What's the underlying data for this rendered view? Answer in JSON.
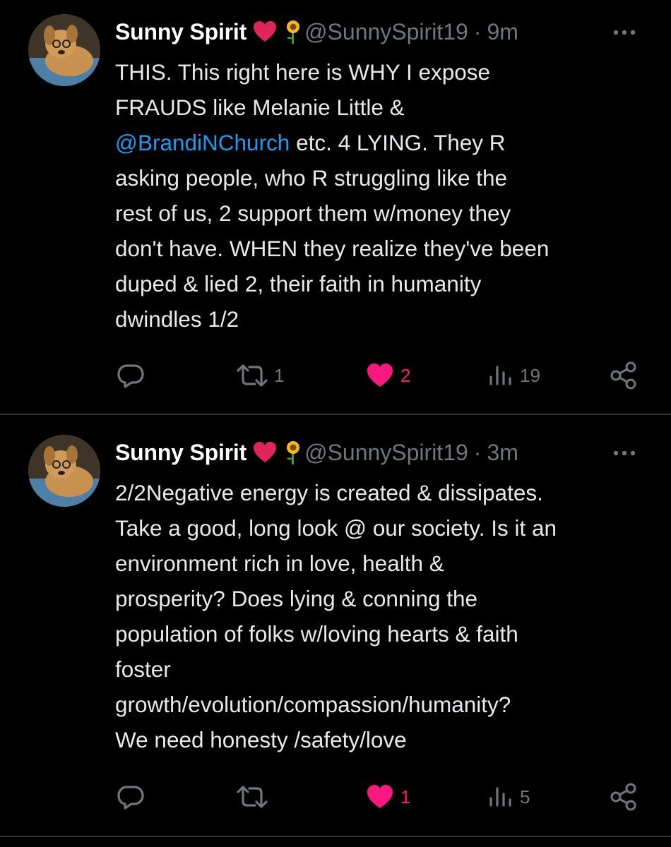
{
  "tweets": [
    {
      "author_name": "Sunny Spirit",
      "handle": "@SunnySpirit19",
      "separator": "·",
      "time": "9m",
      "text_lines": [
        "THIS. This right here is WHY I expose",
        "FRAUDS like Melanie Little &",
        "etc. 4 LYING. They R",
        "asking people, who R  struggling like the",
        "rest of us, 2 support them w/money they",
        "don't have. WHEN they realize they've been",
        "duped & lied 2, their faith in humanity",
        "dwindles 1/2"
      ],
      "mention": "@BrandiNChurch",
      "replies": "",
      "retweets": "1",
      "likes": "2",
      "views": "19"
    },
    {
      "author_name": "Sunny Spirit",
      "handle": "@SunnySpirit19",
      "separator": "·",
      "time": "3m",
      "text_lines": [
        "2/2Negative energy is created & dissipates.",
        "Take a good, long look @ our society. Is it an",
        "environment rich in love, health &",
        "prosperity? Does lying & conning the",
        "population of folks w/loving hearts & faith",
        "foster",
        "growth/evolution/compassion/humanity?",
        "We need honesty /safety/love"
      ],
      "replies": "",
      "retweets": "",
      "likes": "1",
      "views": "5"
    }
  ],
  "icons": {
    "author_badge": "red-heart-icon",
    "author_badge2": "sunflower-icon",
    "more": "more-icon",
    "reply": "reply-icon",
    "retweet": "retweet-icon",
    "like": "like-icon",
    "views": "views-icon",
    "share": "share-icon"
  },
  "colors": {
    "background": "#000000",
    "text": "#e7e9ea",
    "secondary": "#71767b",
    "mention": "#1d9bf0",
    "like": "#f91880",
    "badge_heart": "#e0245e"
  }
}
